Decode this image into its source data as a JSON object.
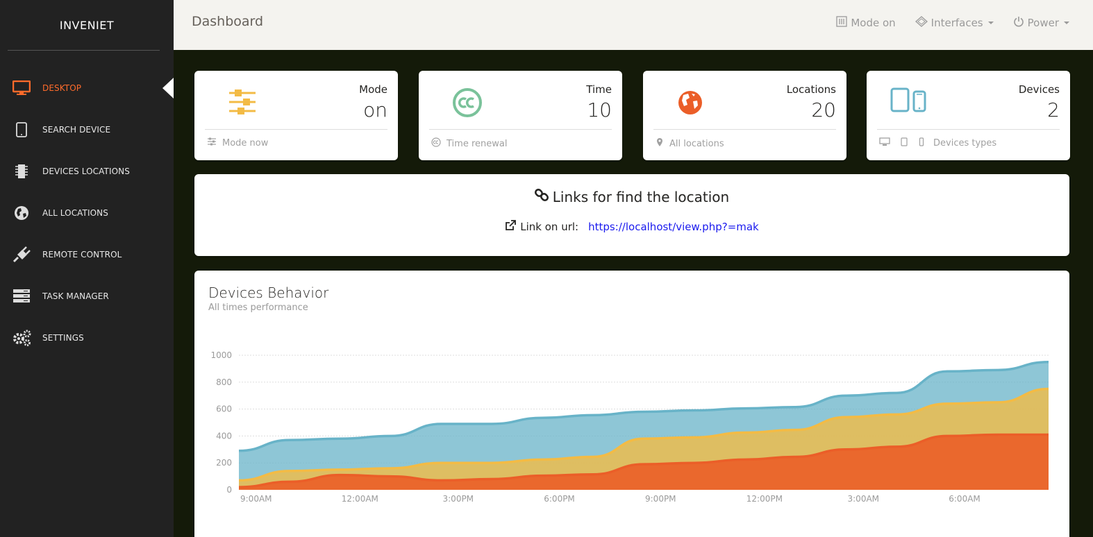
{
  "sidebar": {
    "brand": "INVENIET",
    "items": [
      {
        "label": "DESKTOP",
        "icon": "desktop-icon",
        "active": true
      },
      {
        "label": "SEARCH DEVICE",
        "icon": "tablet-icon"
      },
      {
        "label": "DEVICES LOCATIONS",
        "icon": "chip-icon"
      },
      {
        "label": "ALL LOCATIONS",
        "icon": "globe-icon"
      },
      {
        "label": "REMOTE CONTROL",
        "icon": "plug-icon"
      },
      {
        "label": "TASK MANAGER",
        "icon": "server-icon"
      },
      {
        "label": "SETTINGS",
        "icon": "gears-icon"
      }
    ]
  },
  "topbar": {
    "title": "Dashboard",
    "mode": "Mode on",
    "interfaces": "Interfaces",
    "power": "Power"
  },
  "stats": [
    {
      "label": "Mode",
      "value": "on",
      "footer": "Mode now",
      "icon": "sliders-icon",
      "color": "#f3bb45"
    },
    {
      "label": "Time",
      "value": "10",
      "footer": "Time renewal",
      "icon": "creative-commons-icon",
      "color": "#7ac29a"
    },
    {
      "label": "Locations",
      "value": "20",
      "footer": "All locations",
      "icon": "globe-icon",
      "color": "#eb5e28"
    },
    {
      "label": "Devices",
      "value": "2",
      "footer": "Devices types",
      "icon": "devices-icon",
      "color": "#68b3c8"
    }
  ],
  "links": {
    "title": "Links for find the location",
    "label": "Link on url:",
    "url": "https://localhost/view.php?=mak"
  },
  "chart": {
    "title": "Devices Behavior",
    "subtitle": "All times performance"
  },
  "chart_data": {
    "type": "area",
    "stacked": true,
    "categories": [
      "9:00AM",
      "12:00AM",
      "3:00PM",
      "6:00PM",
      "9:00PM",
      "12:00PM",
      "3:00AM",
      "6:00AM"
    ],
    "x": [
      0,
      0.5,
      1,
      1.5,
      2,
      2.5,
      3,
      3.5,
      4,
      4.5,
      5,
      5.5,
      6,
      6.5,
      7,
      7.5,
      8
    ],
    "ylim": [
      0,
      1000
    ],
    "yticks": [
      0,
      200,
      400,
      600,
      800,
      1000
    ],
    "grid": true,
    "series": [
      {
        "color": "#eb5e28",
        "values": [
          20,
          60,
          110,
          100,
          70,
          80,
          105,
          115,
          190,
          200,
          225,
          245,
          300,
          320,
          400,
          410,
          410
        ]
      },
      {
        "color": "#f3bb45",
        "values": [
          50,
          80,
          40,
          60,
          130,
          120,
          120,
          130,
          190,
          190,
          200,
          200,
          240,
          240,
          240,
          240,
          340
        ]
      },
      {
        "color": "#68b3c8",
        "values": [
          220,
          230,
          230,
          240,
          290,
          290,
          310,
          310,
          200,
          200,
          180,
          170,
          160,
          160,
          240,
          240,
          200
        ]
      }
    ]
  }
}
